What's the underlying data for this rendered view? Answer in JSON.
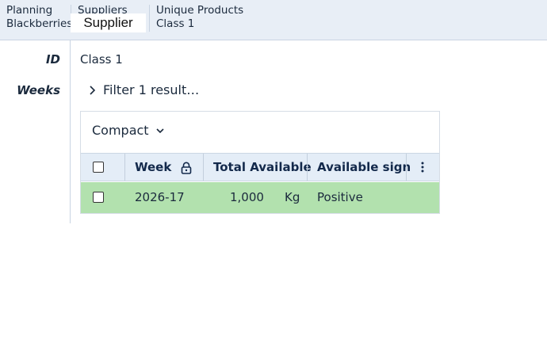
{
  "breadcrumbs": [
    {
      "label": "Planning",
      "sub": "Blackberries"
    },
    {
      "label": "Suppliers",
      "sub": ""
    },
    {
      "label": "Unique Products",
      "sub": "Class 1"
    }
  ],
  "tooltip": "Supplier",
  "fields": {
    "id_label": "ID",
    "id_value": "Class 1",
    "weeks_label": "Weeks",
    "filter_text": "Filter 1 result…"
  },
  "table": {
    "view_mode": "Compact",
    "columns": [
      "Week",
      "Total Available",
      "Available sign"
    ],
    "rows": [
      {
        "week": "2026-17",
        "total": "1,000",
        "unit": "Kg",
        "sign": "Positive"
      }
    ],
    "row_color": "#b2e1ae"
  },
  "colors": {
    "topbar": "#e8eef6",
    "header": "#e4edf7",
    "text": "#1b2a3d"
  }
}
